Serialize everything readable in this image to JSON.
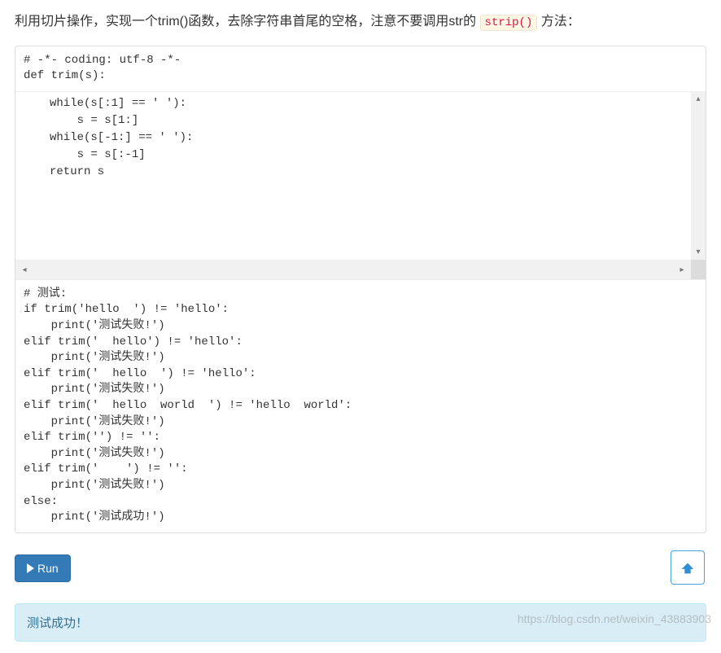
{
  "description": {
    "prefix": "利用切片操作，实现一个trim()函数，去除字符串首尾的空格，注意不要调用str的",
    "code": "strip()",
    "suffix": "方法："
  },
  "code": {
    "header": "# -*- coding: utf-8 -*-\ndef trim(s):",
    "editable": "while(s[:1] == ' '):\n    s = s[1:]\nwhile(s[-1:] == ' '):\n    s = s[:-1]\nreturn s",
    "tests": "# 测试:\nif trim('hello  ') != 'hello':\n    print('测试失败!')\nelif trim('  hello') != 'hello':\n    print('测试失败!')\nelif trim('  hello  ') != 'hello':\n    print('测试失败!')\nelif trim('  hello  world  ') != 'hello  world':\n    print('测试失败!')\nelif trim('') != '':\n    print('测试失败!')\nelif trim('    ') != '':\n    print('测试失败!')\nelse:\n    print('测试成功!')"
  },
  "run_button_label": "Run",
  "output": "测试成功！",
  "watermark": "https://blog.csdn.net/weixin_43883903"
}
